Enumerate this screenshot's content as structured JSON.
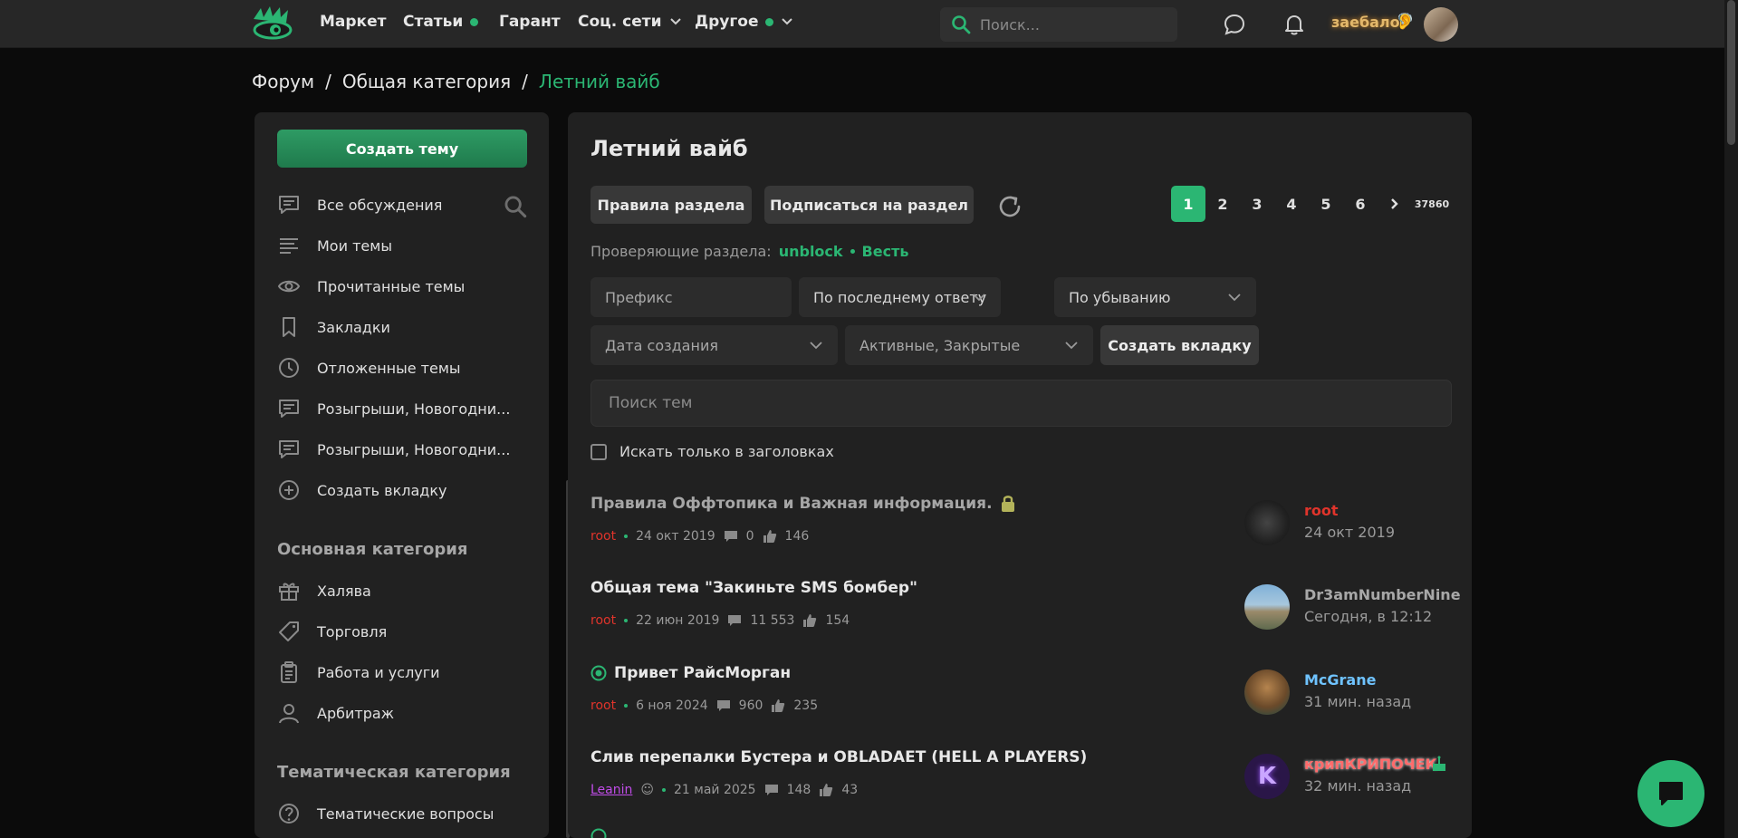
{
  "nav": {
    "items": [
      {
        "label": "Маркет"
      },
      {
        "label": "Статьи"
      },
      {
        "label": "Гарант"
      },
      {
        "label": "Соц. сети"
      },
      {
        "label": "Другое"
      }
    ],
    "search_placeholder": "Поиск...",
    "username": "заебало",
    "user_emoji": "🦻"
  },
  "breadcrumb": {
    "root": "Форум",
    "section": "Общая категория",
    "current": "Летний вайб"
  },
  "sidebar": {
    "create_label": "Создать тему",
    "items": [
      {
        "label": "Все обсуждения"
      },
      {
        "label": "Мои темы"
      },
      {
        "label": "Прочитанные темы"
      },
      {
        "label": "Закладки"
      },
      {
        "label": "Отложенные темы"
      },
      {
        "label": "Розыгрыши, Новогодни..."
      },
      {
        "label": "Розыгрыши, Новогодни..."
      },
      {
        "label": "Создать вкладку"
      }
    ],
    "section_main": "Основная категория",
    "main_items": [
      {
        "label": "Халява"
      },
      {
        "label": "Торговля"
      },
      {
        "label": "Работа и услуги"
      },
      {
        "label": "Арбитраж"
      }
    ],
    "section_thematic": "Тематическая категория",
    "thematic_items": [
      {
        "label": "Тематические вопросы"
      }
    ]
  },
  "main": {
    "title": "Летний вайб",
    "rules_label": "Правила раздела",
    "subscribe_label": "Подписаться на раздел",
    "pages": [
      "1",
      "2",
      "3",
      "4",
      "5",
      "6"
    ],
    "last_page": "37860",
    "reviewers_label": "Проверяющие раздела:",
    "reviewers": [
      "unblock",
      "Весть"
    ],
    "prefix_placeholder": "Префикс",
    "sort_by": "По последнему ответу",
    "sort_order": "По убыванию",
    "date_filter": "Дата создания",
    "status_filter": "Активные, Закрытые",
    "create_tab_label": "Создать вкладку",
    "search_placeholder": "Поиск тем",
    "titles_only_label": "Искать только в заголовках"
  },
  "threads": [
    {
      "title": "Правила Оффтопика и Важная информация.",
      "author": "root",
      "date": "24 окт 2019",
      "replies": "0",
      "likes": "146",
      "last_user": "root",
      "last_time": "24 окт 2019"
    },
    {
      "title": "Общая тема \"Закиньте SMS бомбер\"",
      "author": "root",
      "date": "22 июн 2019",
      "replies": "11 553",
      "likes": "154",
      "last_user": "Dr3amNumberNine",
      "last_time": "Сегодня, в 12:12"
    },
    {
      "title": "Привет РайсМорган",
      "author": "root",
      "date": "6 ноя 2024",
      "replies": "960",
      "likes": "235",
      "last_user": "McGrane",
      "last_time": "31 мин. назад"
    },
    {
      "title": "Слив перепалки Бустера и OBLADAET (HELL A PLAYERS)",
      "author": "Leanin",
      "date": "21 май 2025",
      "replies": "148",
      "likes": "43",
      "last_user": "крипКРИПОЧЕК",
      "last_time": "32 мин. назад"
    }
  ],
  "colors": {
    "accent": "#2bb673",
    "author_red": "#e0342b",
    "author_purple": "#c04ce8",
    "user_blue": "#6fc3ff"
  }
}
